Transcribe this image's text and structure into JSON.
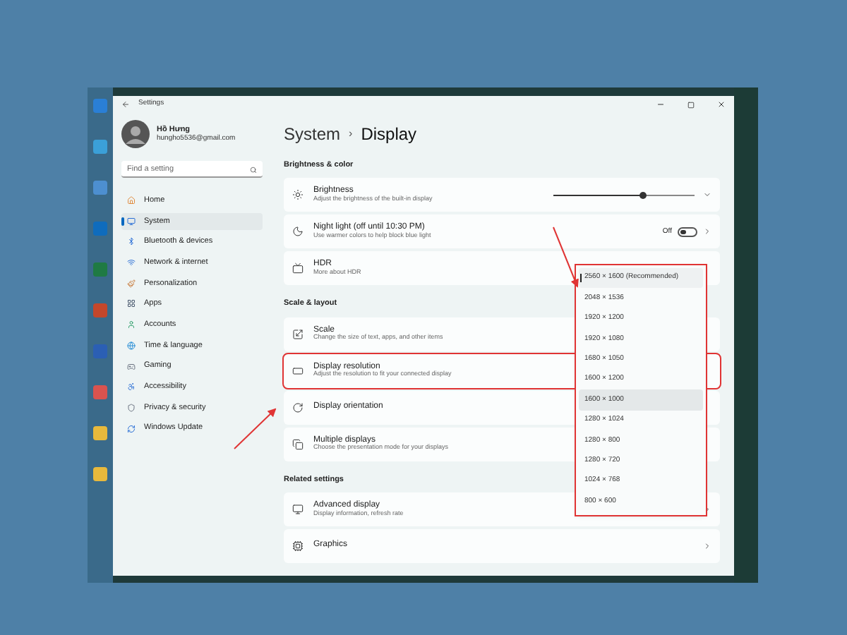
{
  "window": {
    "title": "Settings"
  },
  "profile": {
    "name": "Hồ Hưng",
    "email": "hungho5536@gmail.com"
  },
  "search": {
    "placeholder": "Find a setting"
  },
  "nav": [
    {
      "label": "Home",
      "selected": false
    },
    {
      "label": "System",
      "selected": true
    },
    {
      "label": "Bluetooth & devices",
      "selected": false
    },
    {
      "label": "Network & internet",
      "selected": false
    },
    {
      "label": "Personalization",
      "selected": false
    },
    {
      "label": "Apps",
      "selected": false
    },
    {
      "label": "Accounts",
      "selected": false
    },
    {
      "label": "Time & language",
      "selected": false
    },
    {
      "label": "Gaming",
      "selected": false
    },
    {
      "label": "Accessibility",
      "selected": false
    },
    {
      "label": "Privacy & security",
      "selected": false
    },
    {
      "label": "Windows Update",
      "selected": false
    }
  ],
  "breadcrumb": {
    "parent": "System",
    "separator": "›",
    "current": "Display"
  },
  "sections": [
    {
      "heading": "Brightness & color",
      "cards": [
        {
          "kind": "slider",
          "title": "Brightness",
          "subtitle": "Adjust the brightness of the built-in display",
          "level": 0.63
        },
        {
          "kind": "toggle",
          "title": "Night light (off until 10:30 PM)",
          "subtitle": "Use warmer colors to help block blue light",
          "on": false,
          "state_label": "Off"
        },
        {
          "kind": "plain",
          "title": "HDR",
          "subtitle": "More about HDR"
        }
      ]
    },
    {
      "heading": "Scale & layout",
      "cards": [
        {
          "kind": "plain",
          "title": "Scale",
          "subtitle": "Change the size of text, apps, and other items"
        },
        {
          "kind": "plain",
          "title": "Display resolution",
          "subtitle": "Adjust the resolution to fit your connected display",
          "highlighted": true
        },
        {
          "kind": "plain",
          "title": "Display orientation"
        },
        {
          "kind": "plain",
          "title": "Multiple displays",
          "subtitle": "Choose the presentation mode for your displays"
        }
      ]
    },
    {
      "heading": "Related settings",
      "cards": [
        {
          "kind": "link",
          "title": "Advanced display",
          "subtitle": "Display information, refresh rate"
        },
        {
          "kind": "link",
          "title": "Graphics"
        }
      ]
    }
  ],
  "resolution_menu": {
    "highlighted": true,
    "options": [
      {
        "label": "2560 × 1600 (Recommended)",
        "selected": true,
        "hovered": false
      },
      {
        "label": "2048 × 1536",
        "selected": false,
        "hovered": false
      },
      {
        "label": "1920 × 1200",
        "selected": false,
        "hovered": false
      },
      {
        "label": "1920 × 1080",
        "selected": false,
        "hovered": false
      },
      {
        "label": "1680 × 1050",
        "selected": false,
        "hovered": false
      },
      {
        "label": "1600 × 1200",
        "selected": false,
        "hovered": false
      },
      {
        "label": "1600 × 1000",
        "selected": false,
        "hovered": true
      },
      {
        "label": "1280 × 1024",
        "selected": false,
        "hovered": false
      },
      {
        "label": "1280 × 800",
        "selected": false,
        "hovered": false
      },
      {
        "label": "1280 × 720",
        "selected": false,
        "hovered": false
      },
      {
        "label": "1024 × 768",
        "selected": false,
        "hovered": false
      },
      {
        "label": "800 × 600",
        "selected": false,
        "hovered": false
      }
    ]
  }
}
